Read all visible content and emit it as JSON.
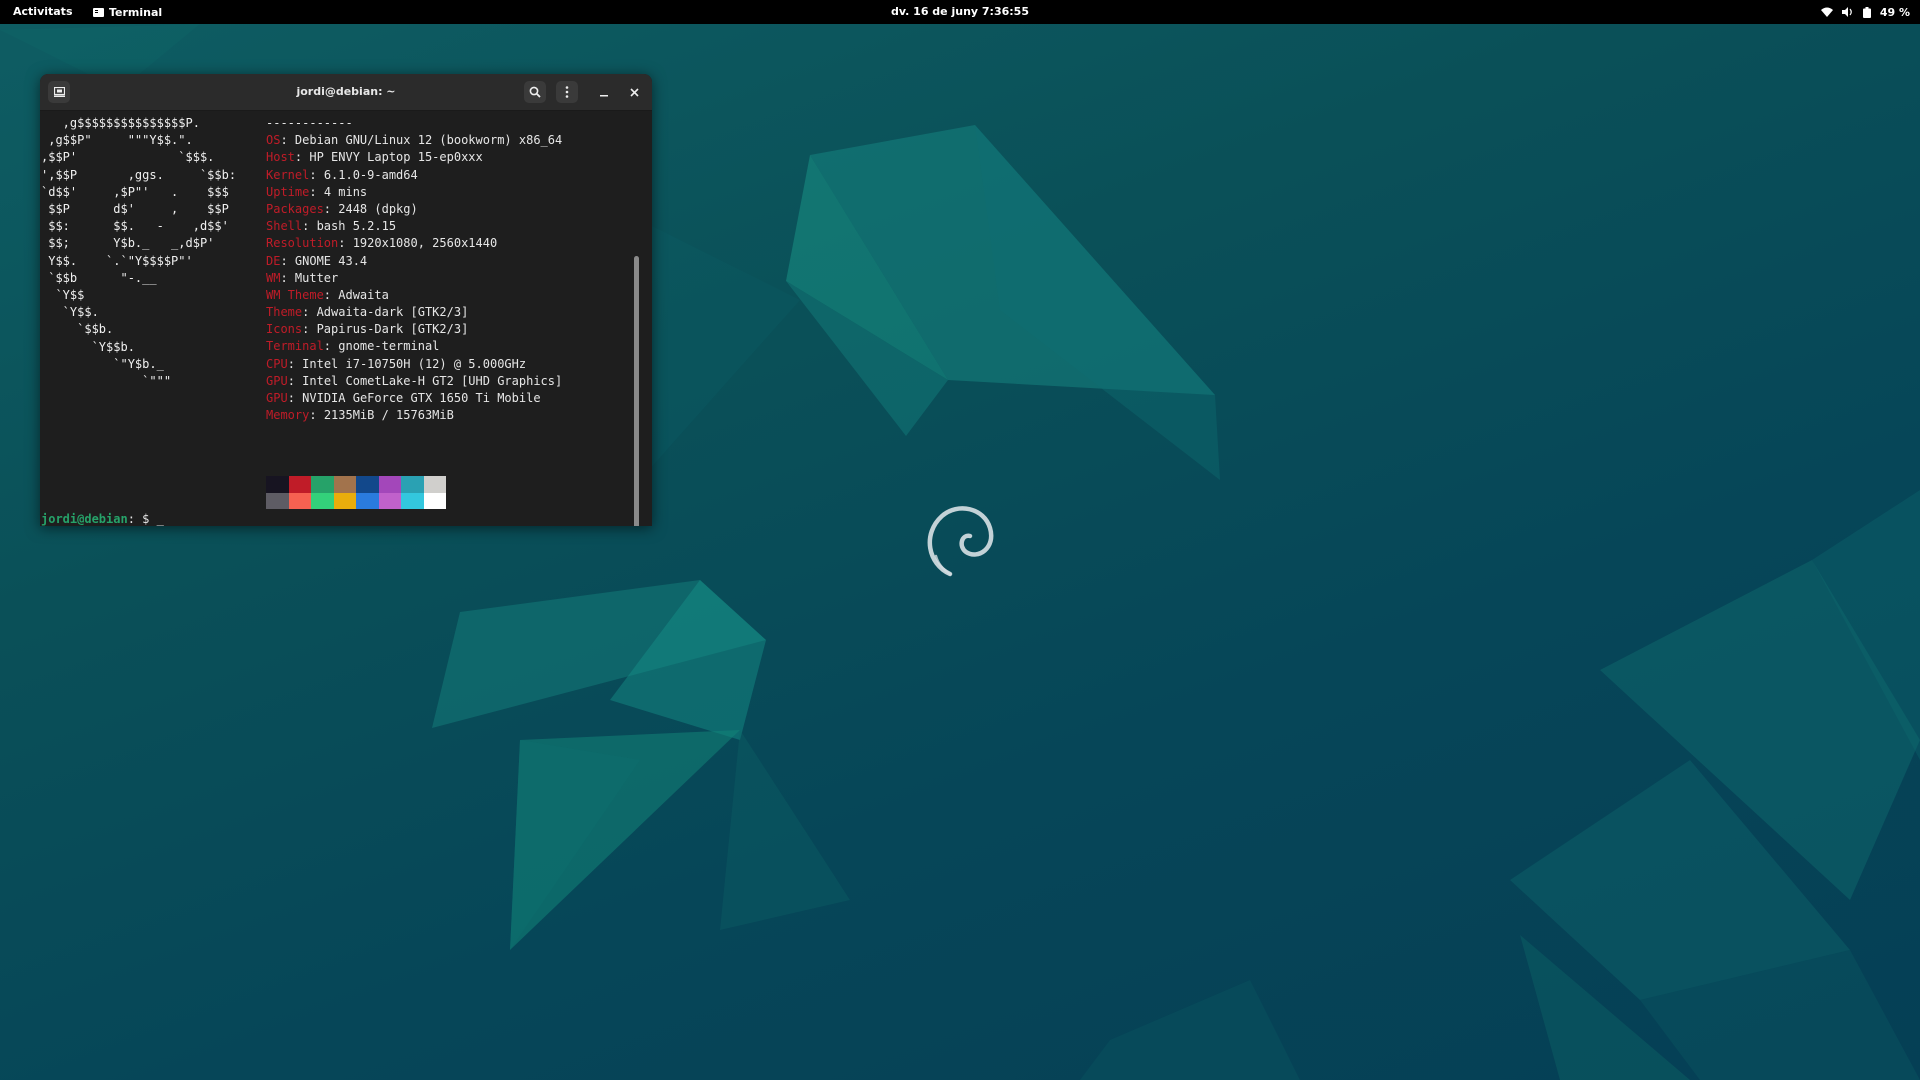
{
  "topbar": {
    "activities": "Activitats",
    "app_name": "Terminal",
    "clock": "dv. 16 de juny 7:36:55",
    "battery": "49 %",
    "icons": [
      "wifi-icon",
      "volume-icon",
      "battery-icon"
    ]
  },
  "terminal": {
    "title": "jordi@debian: ~",
    "header_icons": [
      "new-tab-icon",
      "search-icon",
      "menu-icon",
      "minimize-icon",
      "close-icon"
    ],
    "neofetch": {
      "separator": "------------",
      "ascii_art": [
        "   ,g$$$$$$$$$$$$$$$P.",
        " ,g$$P\"     \"\"\"Y$$.\".",
        ",$$P'              `$$$.",
        "',$$P       ,ggs.     `$$b:",
        "`d$$'     ,$P\"'   .    $$$",
        " $$P      d$'     ,    $$P",
        " $$:      $$.   -    ,d$$'",
        " $$;      Y$b._   _,d$P'",
        " Y$$.    `.`\"Y$$$$P\"'",
        " `$$b      \"-.__",
        "  `Y$$",
        "   `Y$$.",
        "     `$$b.",
        "       `Y$$b.",
        "          `\"Y$b._",
        "              `\"\"\""
      ],
      "info": [
        {
          "key": "OS",
          "value": "Debian GNU/Linux 12 (bookworm) x86_64"
        },
        {
          "key": "Host",
          "value": "HP ENVY Laptop 15-ep0xxx"
        },
        {
          "key": "Kernel",
          "value": "6.1.0-9-amd64"
        },
        {
          "key": "Uptime",
          "value": "4 mins"
        },
        {
          "key": "Packages",
          "value": "2448 (dpkg)"
        },
        {
          "key": "Shell",
          "value": "bash 5.2.15"
        },
        {
          "key": "Resolution",
          "value": "1920x1080, 2560x1440"
        },
        {
          "key": "DE",
          "value": "GNOME 43.4"
        },
        {
          "key": "WM",
          "value": "Mutter"
        },
        {
          "key": "WM Theme",
          "value": "Adwaita"
        },
        {
          "key": "Theme",
          "value": "Adwaita-dark [GTK2/3]"
        },
        {
          "key": "Icons",
          "value": "Papirus-Dark [GTK2/3]"
        },
        {
          "key": "Terminal",
          "value": "gnome-terminal"
        },
        {
          "key": "CPU",
          "value": "Intel i7-10750H (12) @ 5.000GHz"
        },
        {
          "key": "GPU",
          "value": "Intel CometLake-H GT2 [UHD Graphics]"
        },
        {
          "key": "GPU",
          "value": "NVIDIA GeForce GTX 1650 Ti Mobile"
        },
        {
          "key": "Memory",
          "value": "2135MiB / 15763MiB"
        }
      ],
      "palette_row1": [
        "#171421",
        "#c01c28",
        "#26a269",
        "#a2734c",
        "#12488b",
        "#a347ba",
        "#2aa1b3",
        "#d0cfcc"
      ],
      "palette_row2": [
        "#5e5c64",
        "#f66151",
        "#33d17a",
        "#e9ad0c",
        "#2a7bde",
        "#c061cb",
        "#33c7de",
        "#ffffff"
      ]
    },
    "prompt": {
      "user_host": "jordi@debian",
      "path_symbol": ": $ ",
      "cursor": "_"
    }
  },
  "colors": {
    "key_red": "#c01c28",
    "prompt_green": "#26a269",
    "terminal_bg": "#1e1e1e",
    "desktop_teal": "#0a5058"
  }
}
